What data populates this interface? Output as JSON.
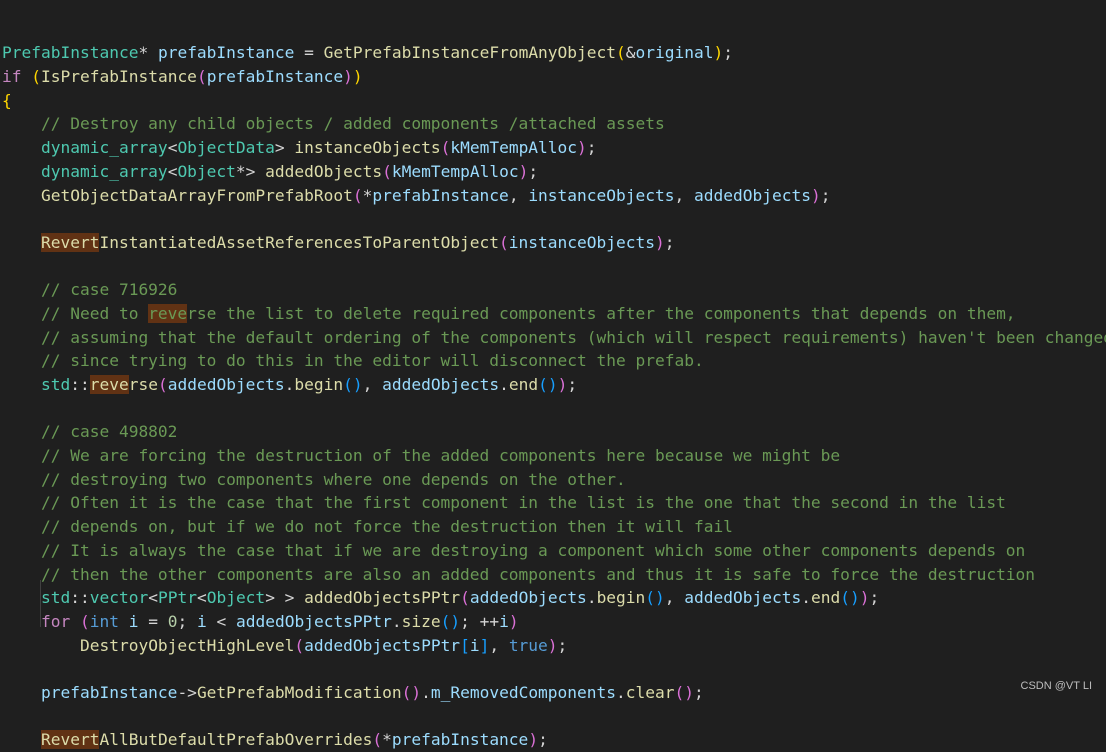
{
  "editor": {
    "lines": [
      [
        [
          "t",
          "PrefabInstance"
        ],
        [
          "p",
          "* "
        ],
        [
          "v",
          "prefabInstance"
        ],
        [
          "p",
          " = "
        ],
        [
          "f",
          "GetPrefabInstanceFromAnyObject"
        ],
        [
          "b1",
          "("
        ],
        [
          "p",
          "&"
        ],
        [
          "v",
          "original"
        ],
        [
          "b1",
          ")"
        ],
        [
          "p",
          ";"
        ]
      ],
      [
        [
          "kc",
          "if"
        ],
        [
          "p",
          " "
        ],
        [
          "b1",
          "("
        ],
        [
          "f",
          "IsPrefabInstance"
        ],
        [
          "b2",
          "("
        ],
        [
          "v",
          "prefabInstance"
        ],
        [
          "b2",
          ")"
        ],
        [
          "b1",
          ")"
        ]
      ],
      [
        [
          "b1",
          "{"
        ]
      ],
      [
        [
          "p",
          "    "
        ],
        [
          "c",
          "// Destroy any child objects / added components /attached assets"
        ]
      ],
      [
        [
          "p",
          "    "
        ],
        [
          "t",
          "dynamic_array"
        ],
        [
          "p",
          "<"
        ],
        [
          "t",
          "ObjectData"
        ],
        [
          "p",
          "> "
        ],
        [
          "f",
          "instanceObjects"
        ],
        [
          "b2",
          "("
        ],
        [
          "v",
          "kMemTempAlloc"
        ],
        [
          "b2",
          ")"
        ],
        [
          "p",
          ";"
        ]
      ],
      [
        [
          "p",
          "    "
        ],
        [
          "t",
          "dynamic_array"
        ],
        [
          "p",
          "<"
        ],
        [
          "t",
          "Object"
        ],
        [
          "p",
          "*> "
        ],
        [
          "f",
          "addedObjects"
        ],
        [
          "b2",
          "("
        ],
        [
          "v",
          "kMemTempAlloc"
        ],
        [
          "b2",
          ")"
        ],
        [
          "p",
          ";"
        ]
      ],
      [
        [
          "p",
          "    "
        ],
        [
          "f",
          "GetObjectDataArrayFromPrefabRoot"
        ],
        [
          "b2",
          "("
        ],
        [
          "p",
          "*"
        ],
        [
          "v",
          "prefabInstance"
        ],
        [
          "p",
          ", "
        ],
        [
          "v",
          "instanceObjects"
        ],
        [
          "p",
          ", "
        ],
        [
          "v",
          "addedObjects"
        ],
        [
          "b2",
          ")"
        ],
        [
          "p",
          ";"
        ]
      ],
      [],
      [
        [
          "p",
          "    "
        ],
        [
          "fh",
          "Revert"
        ],
        [
          "f",
          "InstantiatedAssetReferencesToParentObject"
        ],
        [
          "b2",
          "("
        ],
        [
          "v",
          "instanceObjects"
        ],
        [
          "b2",
          ")"
        ],
        [
          "p",
          ";"
        ]
      ],
      [],
      [
        [
          "p",
          "    "
        ],
        [
          "c",
          "// case 716926"
        ]
      ],
      [
        [
          "p",
          "    "
        ],
        [
          "c",
          "// Need to "
        ],
        [
          "ch",
          "reve"
        ],
        [
          "c",
          "rse the list to delete required components after the components that depends on them,"
        ]
      ],
      [
        [
          "p",
          "    "
        ],
        [
          "c",
          "// assuming that the default ordering of the components (which will respect requirements) haven't been changed,"
        ]
      ],
      [
        [
          "p",
          "    "
        ],
        [
          "c",
          "// since trying to do this in the editor will disconnect the prefab."
        ]
      ],
      [
        [
          "p",
          "    "
        ],
        [
          "t",
          "std"
        ],
        [
          "p",
          "::"
        ],
        [
          "fh",
          "reve"
        ],
        [
          "f",
          "rse"
        ],
        [
          "b2",
          "("
        ],
        [
          "v",
          "addedObjects"
        ],
        [
          "p",
          "."
        ],
        [
          "f",
          "begin"
        ],
        [
          "b3",
          "()"
        ],
        [
          "p",
          ", "
        ],
        [
          "v",
          "addedObjects"
        ],
        [
          "p",
          "."
        ],
        [
          "f",
          "end"
        ],
        [
          "b3",
          "()"
        ],
        [
          "b2",
          ")"
        ],
        [
          "p",
          ";"
        ]
      ],
      [],
      [
        [
          "p",
          "    "
        ],
        [
          "c",
          "// case 498802"
        ]
      ],
      [
        [
          "p",
          "    "
        ],
        [
          "c",
          "// We are forcing the destruction of the added components here because we might be"
        ]
      ],
      [
        [
          "p",
          "    "
        ],
        [
          "c",
          "// destroying two components where one depends on the other."
        ]
      ],
      [
        [
          "p",
          "    "
        ],
        [
          "c",
          "// Often it is the case that the first component in the list is the one that the second in the list"
        ]
      ],
      [
        [
          "p",
          "    "
        ],
        [
          "c",
          "// depends on, but if we do not force the destruction then it will fail"
        ]
      ],
      [
        [
          "p",
          "    "
        ],
        [
          "c",
          "// It is always the case that if we are destroying a component which some other components depends on"
        ]
      ],
      [
        [
          "p",
          "    "
        ],
        [
          "c",
          "// then the other components are also an added components and thus it is safe to force the destruction"
        ]
      ],
      [
        [
          "p",
          "    "
        ],
        [
          "t",
          "std"
        ],
        [
          "p",
          "::"
        ],
        [
          "t",
          "vector"
        ],
        [
          "p",
          "<"
        ],
        [
          "t",
          "PPtr"
        ],
        [
          "p",
          "<"
        ],
        [
          "t",
          "Object"
        ],
        [
          "p",
          "> > "
        ],
        [
          "f",
          "addedObjectsPPtr"
        ],
        [
          "b2",
          "("
        ],
        [
          "v",
          "addedObjects"
        ],
        [
          "p",
          "."
        ],
        [
          "f",
          "begin"
        ],
        [
          "b3",
          "()"
        ],
        [
          "p",
          ", "
        ],
        [
          "v",
          "addedObjects"
        ],
        [
          "p",
          "."
        ],
        [
          "f",
          "end"
        ],
        [
          "b3",
          "()"
        ],
        [
          "b2",
          ")"
        ],
        [
          "p",
          ";"
        ]
      ],
      [
        [
          "p",
          "    "
        ],
        [
          "kc",
          "for"
        ],
        [
          "p",
          " "
        ],
        [
          "b2",
          "("
        ],
        [
          "k",
          "int"
        ],
        [
          "p",
          " "
        ],
        [
          "v",
          "i"
        ],
        [
          "p",
          " = "
        ],
        [
          "n",
          "0"
        ],
        [
          "p",
          "; "
        ],
        [
          "v",
          "i"
        ],
        [
          "p",
          " < "
        ],
        [
          "v",
          "addedObjectsPPtr"
        ],
        [
          "p",
          "."
        ],
        [
          "f",
          "size"
        ],
        [
          "b3",
          "()"
        ],
        [
          "p",
          "; ++"
        ],
        [
          "v",
          "i"
        ],
        [
          "b2",
          ")"
        ]
      ],
      [
        [
          "p",
          "        "
        ],
        [
          "f",
          "DestroyObjectHighLevel"
        ],
        [
          "b2",
          "("
        ],
        [
          "v",
          "addedObjectsPPtr"
        ],
        [
          "b3",
          "["
        ],
        [
          "v",
          "i"
        ],
        [
          "b3",
          "]"
        ],
        [
          "p",
          ", "
        ],
        [
          "k",
          "true"
        ],
        [
          "b2",
          ")"
        ],
        [
          "p",
          ";"
        ]
      ],
      [],
      [
        [
          "p",
          "    "
        ],
        [
          "v",
          "prefabInstance"
        ],
        [
          "p",
          "->"
        ],
        [
          "f",
          "GetPrefabModification"
        ],
        [
          "b2",
          "()"
        ],
        [
          "p",
          "."
        ],
        [
          "v",
          "m_RemovedComponents"
        ],
        [
          "p",
          "."
        ],
        [
          "f",
          "clear"
        ],
        [
          "b2",
          "()"
        ],
        [
          "p",
          ";"
        ]
      ],
      [],
      [
        [
          "p",
          "    "
        ],
        [
          "fh",
          "Revert"
        ],
        [
          "f",
          "AllButDefaultPrefabOverrides"
        ],
        [
          "b2",
          "("
        ],
        [
          "p",
          "*"
        ],
        [
          "v",
          "prefabInstance"
        ],
        [
          "b2",
          ")"
        ],
        [
          "p",
          ";"
        ]
      ]
    ]
  },
  "watermark": "CSDN @VT LI"
}
